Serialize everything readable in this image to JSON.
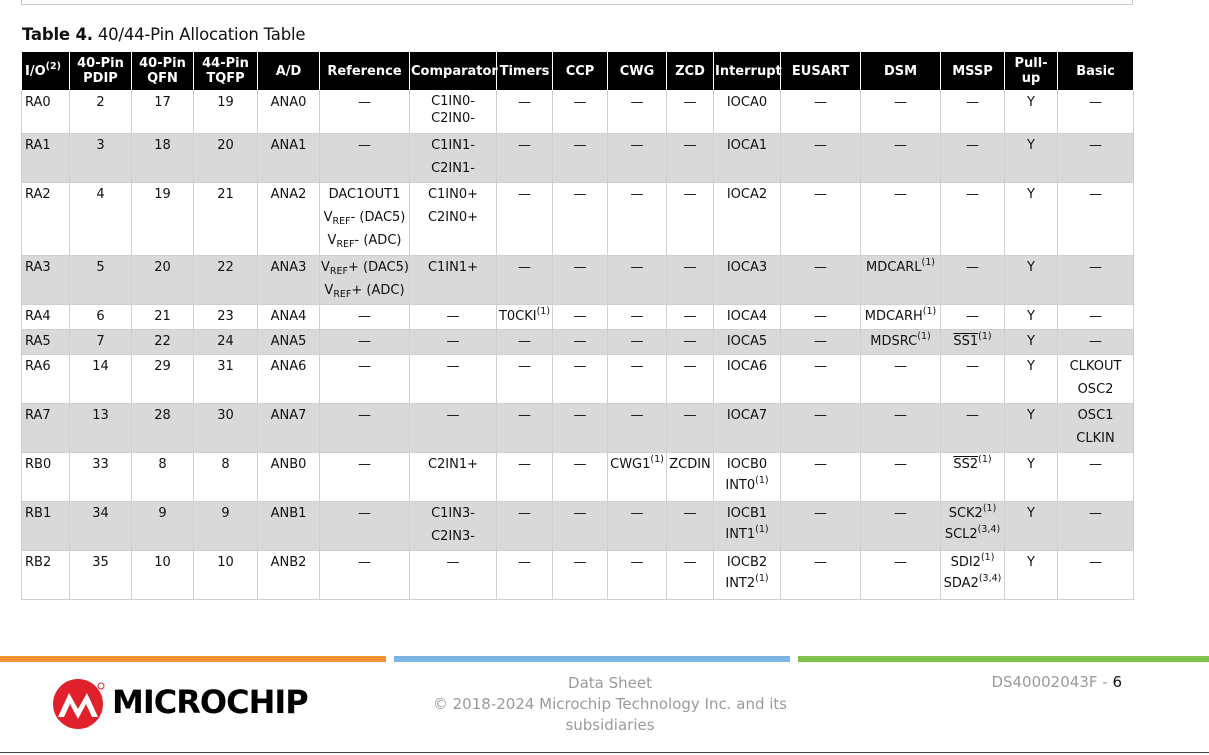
{
  "caption": {
    "label": "Table 4.",
    "title": "40/44-Pin Allocation Table"
  },
  "headers": {
    "io": "I/O",
    "io_note": "(2)",
    "pdip": [
      "40-Pin",
      "PDIP"
    ],
    "qfn": [
      "40-Pin",
      "QFN"
    ],
    "tqfp": [
      "44-Pin",
      "TQFP"
    ],
    "ad": "A/D",
    "reference": "Reference",
    "comparator": "Comparator",
    "timers": "Timers",
    "ccp": "CCP",
    "cwg": "CWG",
    "zcd": "ZCD",
    "interrupt": "Interrupt",
    "eusart": "EUSART",
    "dsm": "DSM",
    "mssp": "MSSP",
    "pullup": "Pull-up",
    "basic": "Basic"
  },
  "dash": "—",
  "rows": {
    "ra0": {
      "io": "RA0",
      "pdip": "2",
      "qfn": "17",
      "tqfp": "19",
      "ad": "ANA0",
      "comp": [
        "C1IN0-",
        "C2IN0-"
      ],
      "int": "IOCA0",
      "pullup": "Y"
    },
    "ra1": {
      "io": "RA1",
      "pdip": "3",
      "qfn": "18",
      "tqfp": "20",
      "ad": "ANA1",
      "comp": [
        "C1IN1-",
        "C2IN1-"
      ],
      "int": "IOCA1",
      "pullup": "Y"
    },
    "ra2": {
      "io": "RA2",
      "pdip": "4",
      "qfn": "19",
      "tqfp": "21",
      "ad": "ANA2",
      "ref": {
        "l1": "DAC1OUT1",
        "v": "V",
        "sub": "REF",
        "l2": "- (DAC5)",
        "l3": "- (ADC)"
      },
      "comp": [
        "C1IN0+",
        "C2IN0+"
      ],
      "int": "IOCA2",
      "pullup": "Y"
    },
    "ra3": {
      "io": "RA3",
      "pdip": "5",
      "qfn": "20",
      "tqfp": "22",
      "ad": "ANA3",
      "ref": {
        "v": "V",
        "sub": "REF",
        "l1": "+ (DAC5)",
        "l2": "+ (ADC)"
      },
      "comp": "C1IN1+",
      "int": "IOCA3",
      "dsm": "MDCARL",
      "dsm_note": "(1)",
      "pullup": "Y"
    },
    "ra4": {
      "io": "RA4",
      "pdip": "6",
      "qfn": "21",
      "tqfp": "23",
      "ad": "ANA4",
      "timers": "T0CKI",
      "timers_note": "(1)",
      "int": "IOCA4",
      "dsm": "MDCARH",
      "dsm_note": "(1)",
      "pullup": "Y"
    },
    "ra5": {
      "io": "RA5",
      "pdip": "7",
      "qfn": "22",
      "tqfp": "24",
      "ad": "ANA5",
      "int": "IOCA5",
      "dsm": "MDSRC",
      "dsm_note": "(1)",
      "mssp": "SS1",
      "mssp_note": "(1)",
      "pullup": "Y"
    },
    "ra6": {
      "io": "RA6",
      "pdip": "14",
      "qfn": "29",
      "tqfp": "31",
      "ad": "ANA6",
      "int": "IOCA6",
      "pullup": "Y",
      "basic": [
        "CLKOUT",
        "OSC2"
      ]
    },
    "ra7": {
      "io": "RA7",
      "pdip": "13",
      "qfn": "28",
      "tqfp": "30",
      "ad": "ANA7",
      "int": "IOCA7",
      "pullup": "Y",
      "basic": [
        "OSC1",
        "CLKIN"
      ]
    },
    "rb0": {
      "io": "RB0",
      "pdip": "33",
      "qfn": "8",
      "tqfp": "8",
      "ad": "ANB0",
      "comp": "C2IN1+",
      "cwg": "CWG1",
      "cwg_note": "(1)",
      "zcd": "ZCDIN",
      "int": [
        "IOCB0",
        "INT0"
      ],
      "int_note": "(1)",
      "mssp": "SS2",
      "mssp_note": "(1)",
      "pullup": "Y"
    },
    "rb1": {
      "io": "RB1",
      "pdip": "34",
      "qfn": "9",
      "tqfp": "9",
      "ad": "ANB1",
      "comp": [
        "C1IN3-",
        "C2IN3-"
      ],
      "int": [
        "IOCB1",
        "INT1"
      ],
      "int_note": "(1)",
      "mssp": [
        "SCK2",
        "SCL2"
      ],
      "mssp_notes": [
        "(1)",
        "(3,4)"
      ],
      "pullup": "Y"
    },
    "rb2": {
      "io": "RB2",
      "pdip": "35",
      "qfn": "10",
      "tqfp": "10",
      "ad": "ANB2",
      "int": [
        "IOCB2",
        "INT2"
      ],
      "int_note": "(1)",
      "mssp": [
        "SDI2",
        "SDA2"
      ],
      "mssp_notes": [
        "(1)",
        "(3,4)"
      ],
      "pullup": "Y"
    }
  },
  "footer": {
    "logo_text": "MICROCHIP",
    "doc_type": "Data Sheet",
    "copyright": "© 2018-2024 Microchip Technology Inc. and its subsidiaries",
    "doc_id": "DS40002043F",
    "sep": " - ",
    "page": "6"
  },
  "colors": {
    "orange": "#f2912f",
    "blue": "#7ab4e3",
    "green": "#7fc14a",
    "logo_red": "#e0202a"
  }
}
